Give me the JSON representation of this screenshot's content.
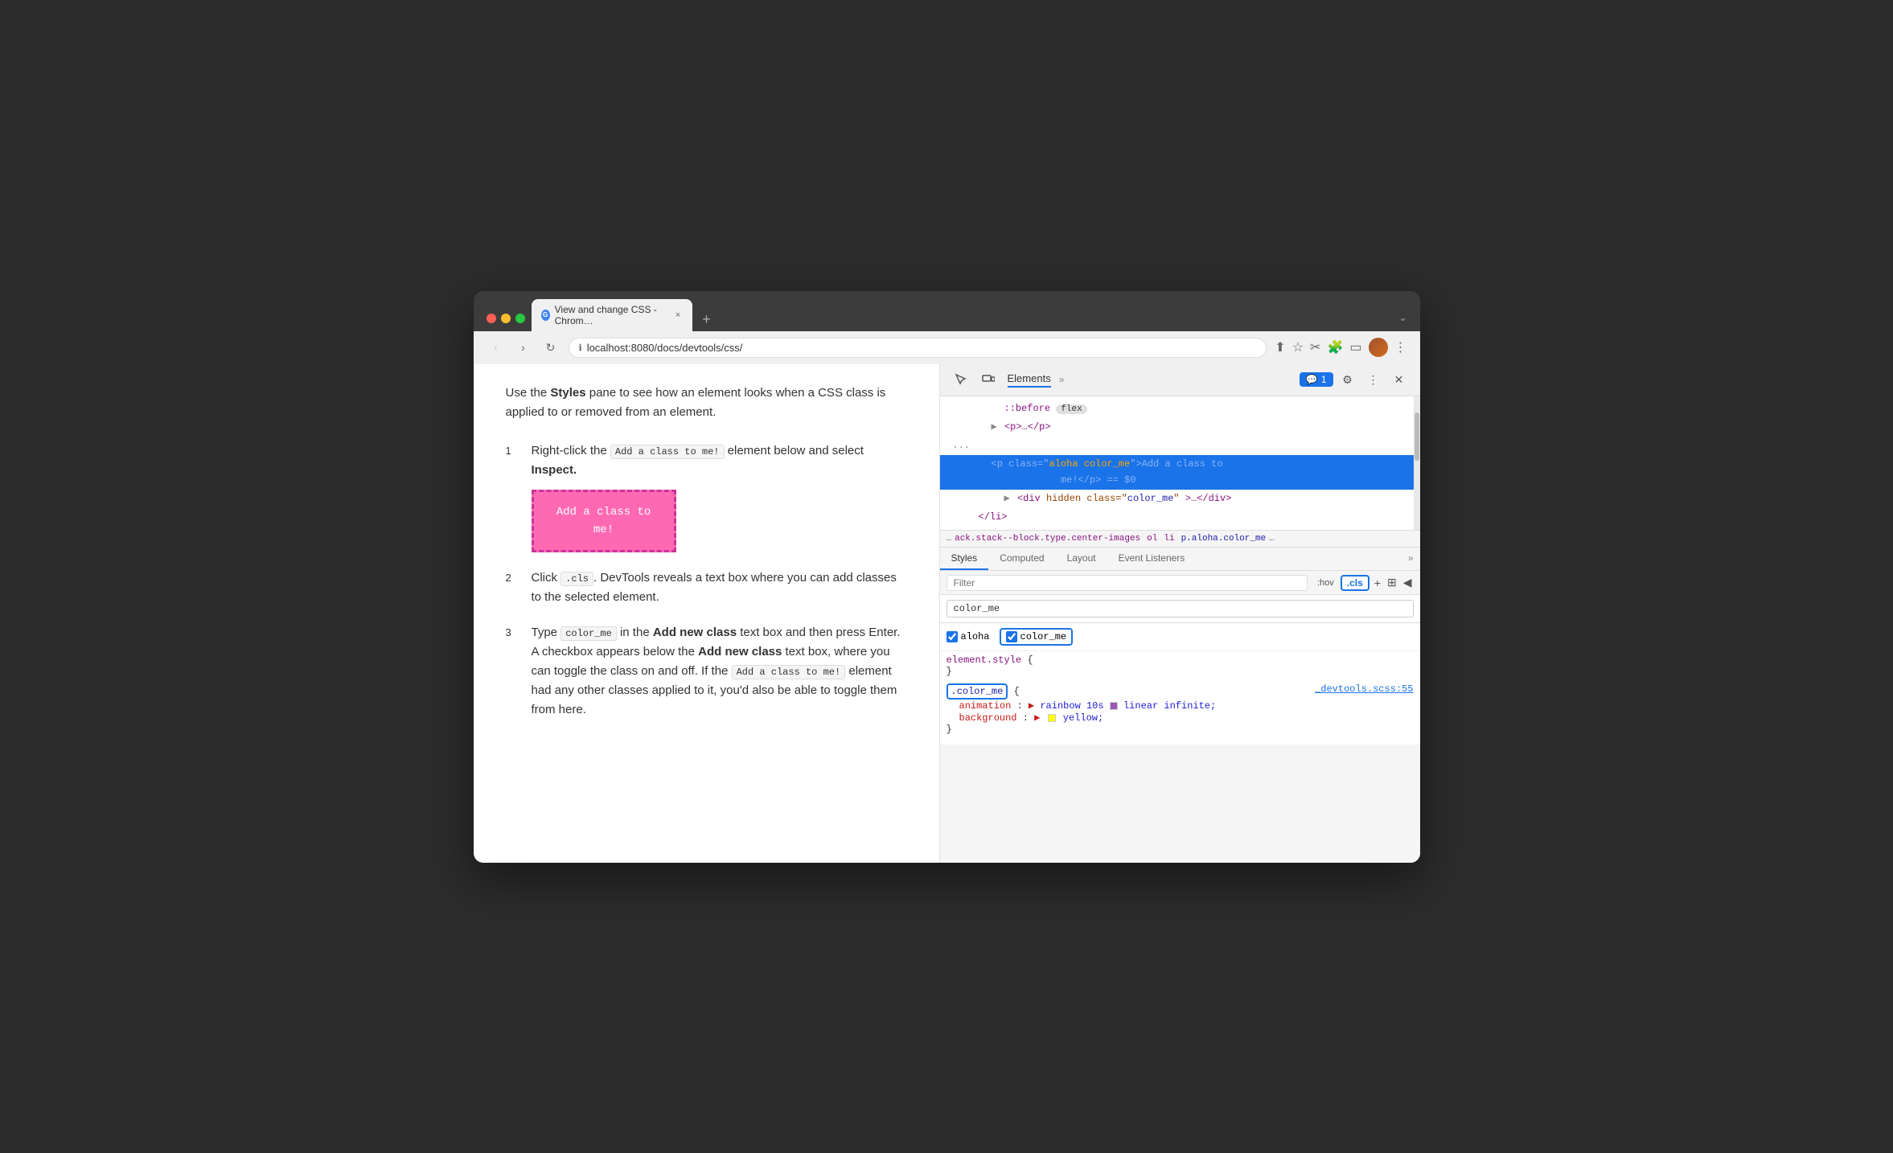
{
  "browser": {
    "title": "View and change CSS - Chrom…",
    "url": "localhost:8080/docs/devtools/css/",
    "tab_close": "×",
    "tab_new": "+",
    "tab_menu": "⌄"
  },
  "tutorial": {
    "intro": "Use the Styles pane to see how an element looks when a CSS class is applied to or removed from an element.",
    "steps": [
      {
        "number": "1",
        "text_before": "Right-click the ",
        "code": "Add a class to me!",
        "text_after": " element below and select ",
        "bold": "Inspect."
      },
      {
        "number": "2",
        "text_before": "Click ",
        "code": ".cls",
        "text_after": ". DevTools reveals a text box where you can add classes to the selected element."
      },
      {
        "number": "3",
        "text_before": "Type ",
        "code": "color_me",
        "text_bold_before": " in the ",
        "bold1": "Add new class",
        "text_middle": " text box and then press Enter. A checkbox appears below the ",
        "bold2": "Add new class",
        "text_after": " text box, where you can toggle the class on and off. If the ",
        "code2": "Add a class to me!",
        "text_end": " element had any other classes applied to it, you'd also be able to toggle them from here."
      }
    ],
    "demo_button": "Add a class to me!"
  },
  "devtools": {
    "tabs": {
      "elements_label": "Elements",
      "more": "»",
      "badge": "1",
      "gear": "⚙",
      "more_vert": "⋮",
      "close": "✕"
    },
    "dom": {
      "before_pseudo": "::before",
      "before_badge": "flex",
      "p_collapsed": "<p>…</p>",
      "p_selected_start": "<p class=\"aloha color_me\">Add a class to",
      "p_selected_end": "me!</p> == $0",
      "div_hidden": "<div hidden class=\"color_me\">…</div>",
      "li_close": "</li>"
    },
    "breadcrumb": {
      "dots": "…",
      "item1": "ack.stack--block.type.center-images",
      "item2": "ol",
      "item3": "li",
      "item4": "p.aloha.color_me",
      "more": "…"
    },
    "styles_tabs": [
      "Styles",
      "Computed",
      "Layout",
      "Event Listeners",
      "»"
    ],
    "filter": {
      "placeholder": "Filter",
      "hov": ":hov",
      "cls": ".cls"
    },
    "cls_input": {
      "value": "color_me"
    },
    "checkboxes": [
      {
        "label": "aloha",
        "checked": true,
        "highlighted": false
      },
      {
        "label": "color_me",
        "checked": true,
        "highlighted": true
      }
    ],
    "css_rules": [
      {
        "selector": "element.style",
        "open_brace": "{",
        "close_brace": "}"
      },
      {
        "selector": ".color_me",
        "source": "_devtools.scss:55",
        "props": [
          {
            "name": "animation",
            "value": "▶ rainbow 10s 🟪 linear infinite;"
          },
          {
            "name": "background",
            "value": "▶ 🟨 yellow;"
          }
        ],
        "highlighted": true
      }
    ]
  }
}
